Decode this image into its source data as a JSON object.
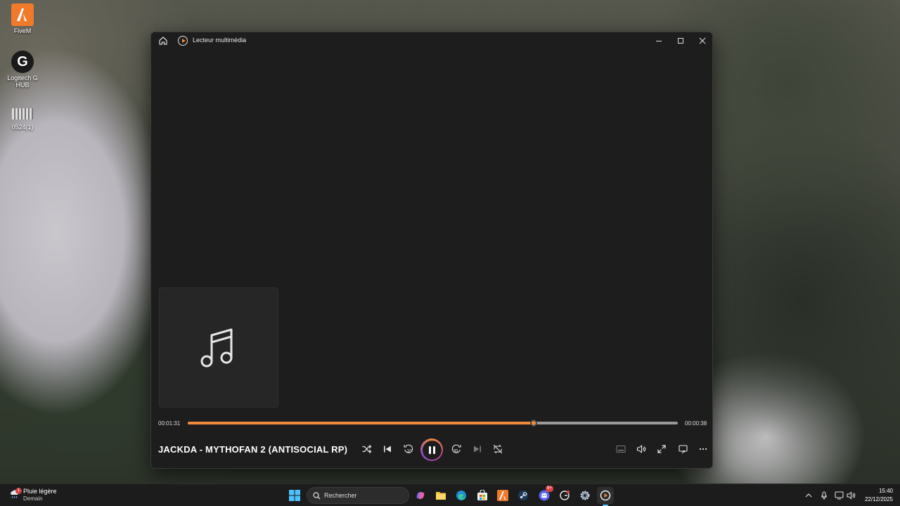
{
  "desktop": {
    "icons": [
      {
        "label": "FiveM",
        "icon": "fivem-icon"
      },
      {
        "label": "Logitech G HUB",
        "icon": "logitech-ghub-icon"
      },
      {
        "label": "0524(1)",
        "icon": "video-file-icon"
      }
    ]
  },
  "window": {
    "title": "Lecteur multimédia",
    "controls": [
      "minimize-icon",
      "maximize-icon",
      "close-icon"
    ]
  },
  "player": {
    "elapsed": "00:01:31",
    "remaining": "00:00:38",
    "progress": 0.7055,
    "track_title": "JACKDA - MYTHOFAN 2 (ANTISOCIAL RP)",
    "state": "playing",
    "skip_back_seconds": "10",
    "skip_forward_seconds": "30",
    "accent_color": "#f08a3c"
  },
  "taskbar": {
    "weather": {
      "condition": "Pluie légère",
      "day": "Demain",
      "badge": "1"
    },
    "search_placeholder": "Rechercher",
    "apps": [
      "start-icon",
      "search-icon",
      "copilot-icon",
      "file-explorer-icon",
      "edge-icon",
      "store-icon",
      "fivem-icon",
      "steam-icon",
      "discord-icon",
      "ghub-icon",
      "settings-icon",
      "media-player-icon"
    ],
    "discord_badge": "9+",
    "clock": {
      "time": "15:40",
      "date": "22/12/2025"
    }
  }
}
